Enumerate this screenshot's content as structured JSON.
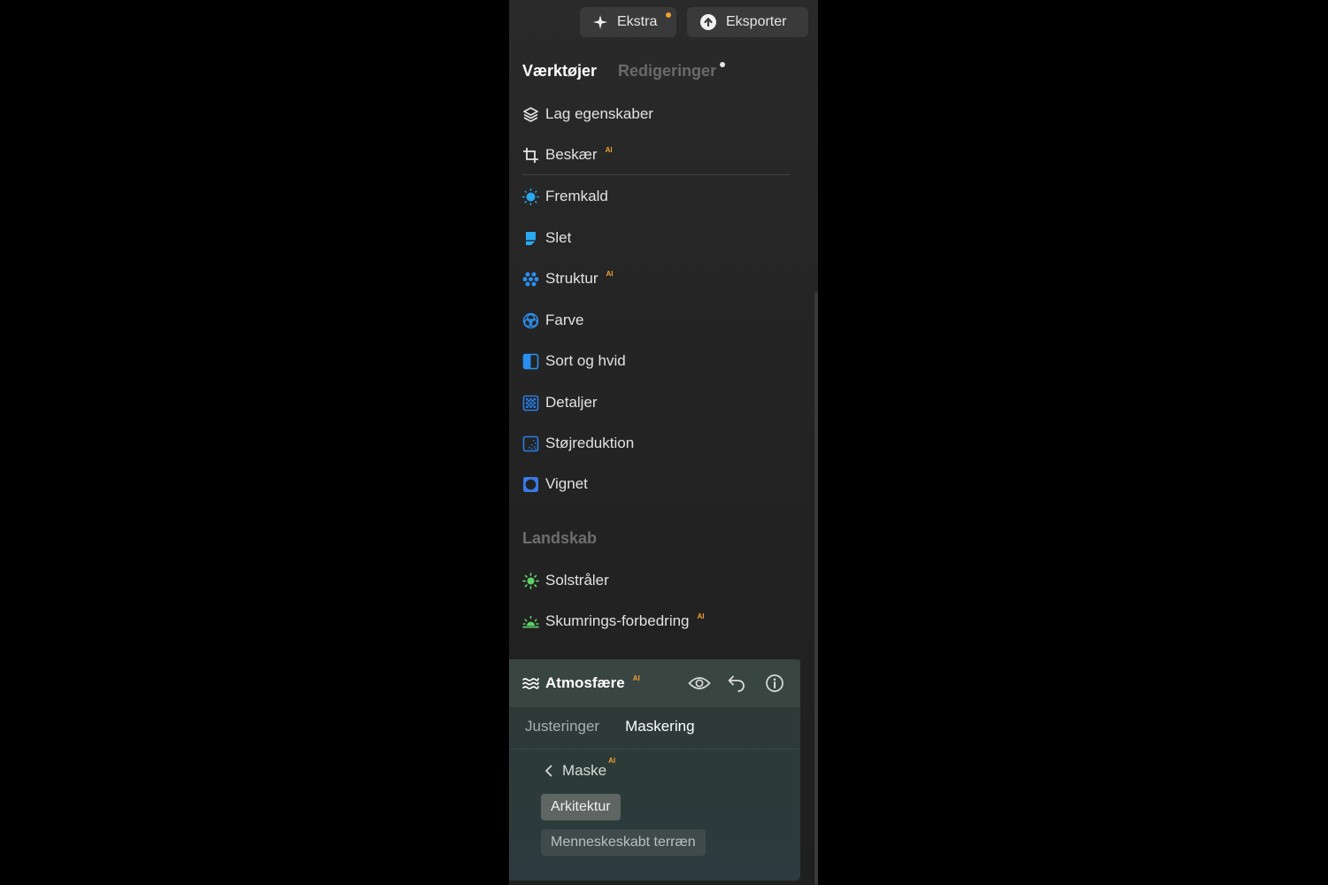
{
  "header": {
    "ekstra_label": "Ekstra",
    "eksporter_label": "Eksporter"
  },
  "tabs": {
    "tools": "Værktøjer",
    "edits": "Redigeringer"
  },
  "tools": [
    {
      "label": "Lag egenskaber",
      "icon": "layers-icon",
      "ai": false
    },
    {
      "label": "Beskær",
      "icon": "crop-icon",
      "ai": true
    },
    {
      "label": "Fremkald",
      "icon": "sun-develop-icon",
      "ai": false
    },
    {
      "label": "Slet",
      "icon": "eraser-icon",
      "ai": false
    },
    {
      "label": "Struktur",
      "icon": "structure-dots-icon",
      "ai": true
    },
    {
      "label": "Farve",
      "icon": "color-circles-icon",
      "ai": false
    },
    {
      "label": "Sort og hvid",
      "icon": "black-white-icon",
      "ai": false
    },
    {
      "label": "Detaljer",
      "icon": "details-grid-icon",
      "ai": false
    },
    {
      "label": "Støjreduktion",
      "icon": "noise-reduction-icon",
      "ai": false
    },
    {
      "label": "Vignet",
      "icon": "vignette-icon",
      "ai": false
    }
  ],
  "landscape": {
    "title": "Landskab",
    "items": [
      {
        "label": "Solstråler",
        "icon": "sun-rays-icon",
        "ai": false
      },
      {
        "label": "Skumrings-forbedring",
        "icon": "sunset-icon",
        "ai": true
      }
    ]
  },
  "ai_badge": "AI",
  "atmosphere": {
    "title": "Atmosfære",
    "tabs": {
      "adjustments": "Justeringer",
      "masking": "Maskering"
    },
    "mask_label": "Maske",
    "chips": [
      "Arkitektur",
      "Menneskeskabt terræn"
    ]
  },
  "colors": {
    "accent_blue": "#2f8de4",
    "accent_green": "#5fd16a",
    "ai_orange": "#f0a030",
    "ekstra_dot": "#f0a030"
  }
}
